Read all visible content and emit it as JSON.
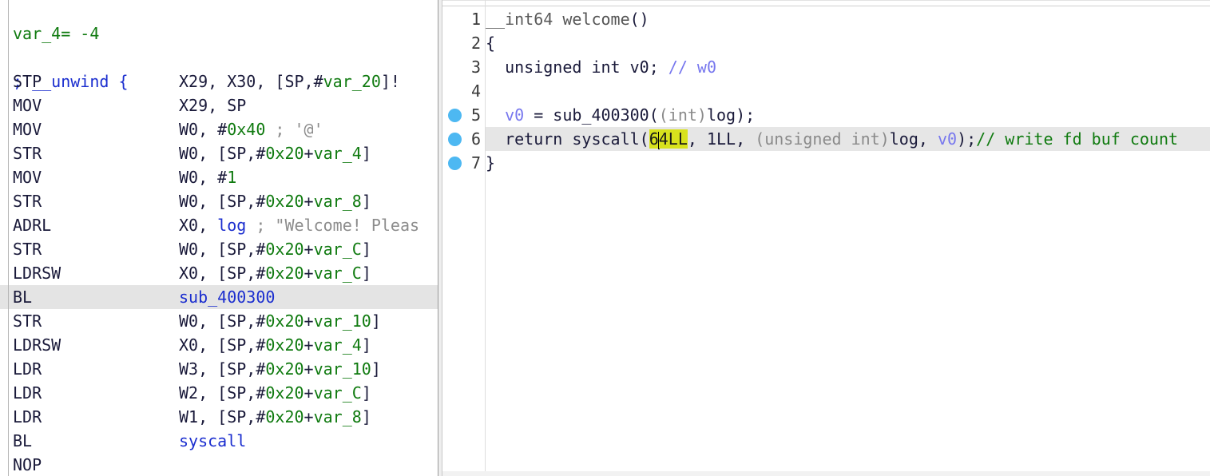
{
  "disasm": {
    "top_partial": "var_4= -4",
    "unwind": "; __unwind {",
    "lines": [
      {
        "mn": "STP",
        "ops": [
          [
            "reg",
            "X29, X30, [SP,#"
          ],
          [
            "var",
            "var_20"
          ],
          [
            "reg",
            "]!"
          ]
        ]
      },
      {
        "mn": "MOV",
        "ops": [
          [
            "reg",
            "X29, SP"
          ]
        ]
      },
      {
        "mn": "MOV",
        "ops": [
          [
            "reg",
            "W0, #"
          ],
          [
            "num",
            "0x40"
          ],
          [
            "cmt",
            " ; '@'"
          ]
        ]
      },
      {
        "mn": "STR",
        "ops": [
          [
            "reg",
            "W0, [SP,#"
          ],
          [
            "num",
            "0x20"
          ],
          [
            "reg",
            "+"
          ],
          [
            "var",
            "var_4"
          ],
          [
            "reg",
            "]"
          ]
        ]
      },
      {
        "mn": "MOV",
        "ops": [
          [
            "reg",
            "W0, #"
          ],
          [
            "num",
            "1"
          ]
        ]
      },
      {
        "mn": "STR",
        "ops": [
          [
            "reg",
            "W0, [SP,#"
          ],
          [
            "num",
            "0x20"
          ],
          [
            "reg",
            "+"
          ],
          [
            "var",
            "var_8"
          ],
          [
            "reg",
            "]"
          ]
        ]
      },
      {
        "mn": "ADRL",
        "ops": [
          [
            "reg",
            "X0, "
          ],
          [
            "sym",
            "log"
          ],
          [
            "cmt",
            " ; \"Welcome! Pleas"
          ]
        ]
      },
      {
        "mn": "STR",
        "ops": [
          [
            "reg",
            "W0, [SP,#"
          ],
          [
            "num",
            "0x20"
          ],
          [
            "reg",
            "+"
          ],
          [
            "var",
            "var_C"
          ],
          [
            "reg",
            "]"
          ]
        ]
      },
      {
        "mn": "LDRSW",
        "ops": [
          [
            "reg",
            "X0, [SP,#"
          ],
          [
            "num",
            "0x20"
          ],
          [
            "reg",
            "+"
          ],
          [
            "var",
            "var_C"
          ],
          [
            "reg",
            "]"
          ]
        ]
      },
      {
        "mn": "BL",
        "ops": [
          [
            "sym",
            "sub_400300"
          ]
        ],
        "highlighted": true
      },
      {
        "mn": "STR",
        "ops": [
          [
            "reg",
            "W0, [SP,#"
          ],
          [
            "num",
            "0x20"
          ],
          [
            "reg",
            "+"
          ],
          [
            "var",
            "var_10"
          ],
          [
            "reg",
            "]"
          ]
        ]
      },
      {
        "mn": "LDRSW",
        "ops": [
          [
            "reg",
            "X0, [SP,#"
          ],
          [
            "num",
            "0x20"
          ],
          [
            "reg",
            "+"
          ],
          [
            "var",
            "var_4"
          ],
          [
            "reg",
            "]"
          ]
        ]
      },
      {
        "mn": "LDR",
        "ops": [
          [
            "reg",
            "W3, [SP,#"
          ],
          [
            "num",
            "0x20"
          ],
          [
            "reg",
            "+"
          ],
          [
            "var",
            "var_10"
          ],
          [
            "reg",
            "]"
          ]
        ]
      },
      {
        "mn": "LDR",
        "ops": [
          [
            "reg",
            "W2, [SP,#"
          ],
          [
            "num",
            "0x20"
          ],
          [
            "reg",
            "+"
          ],
          [
            "var",
            "var_C"
          ],
          [
            "reg",
            "]"
          ]
        ]
      },
      {
        "mn": "LDR",
        "ops": [
          [
            "reg",
            "W1, [SP,#"
          ],
          [
            "num",
            "0x20"
          ],
          [
            "reg",
            "+"
          ],
          [
            "var",
            "var_8"
          ],
          [
            "reg",
            "]"
          ]
        ]
      },
      {
        "mn": "BL",
        "ops": [
          [
            "sym",
            "syscall"
          ]
        ]
      },
      {
        "mn": "NOP",
        "ops": []
      }
    ]
  },
  "pseudocode": {
    "lines": [
      {
        "num": "1",
        "bp": false,
        "tokens": [
          [
            "ty",
            "__int64 "
          ],
          [
            "fn-grey",
            "welcome"
          ],
          [
            "kw",
            "()"
          ]
        ]
      },
      {
        "num": "2",
        "bp": false,
        "tokens": [
          [
            "kw",
            "{"
          ]
        ]
      },
      {
        "num": "3",
        "bp": false,
        "tokens": [
          [
            "kw",
            "  unsigned int v0; "
          ],
          [
            "v0",
            "// w0"
          ]
        ]
      },
      {
        "num": "4",
        "bp": false,
        "tokens": []
      },
      {
        "num": "5",
        "bp": true,
        "tokens": [
          [
            "v0",
            "  v0"
          ],
          [
            "kw",
            " = sub_400300("
          ],
          [
            "cast",
            "(int)"
          ],
          [
            "kw",
            "log);"
          ]
        ]
      },
      {
        "num": "6",
        "bp": true,
        "highlighted": true,
        "tokens": [
          [
            "kw",
            "  return syscall("
          ],
          [
            "yl",
            "6"
          ],
          [
            "caret",
            ""
          ],
          [
            "yl",
            "4"
          ],
          [
            "yl",
            "LL"
          ],
          [
            "kw",
            ", 1LL, "
          ],
          [
            "cast",
            "(unsigned int)"
          ],
          [
            "kw",
            "log, "
          ],
          [
            "v0",
            "v0"
          ],
          [
            "kw",
            ");"
          ],
          [
            "cmtgreen",
            "// write fd buf count"
          ]
        ]
      },
      {
        "num": "7",
        "bp": true,
        "tokens": [
          [
            "kw",
            "}"
          ]
        ]
      }
    ]
  },
  "colors": {
    "breakpoint": "#4db8f2",
    "highlight_line": "#e6e6e6",
    "search_highlight": "#d8e21d"
  }
}
